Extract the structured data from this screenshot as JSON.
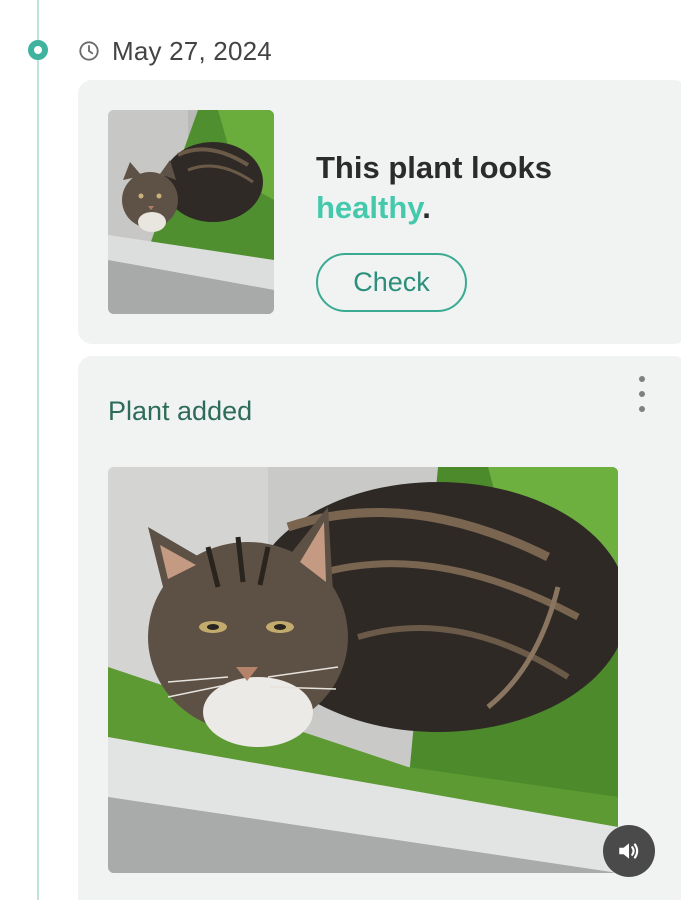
{
  "timeline": {
    "date": "May 27, 2024",
    "clock_icon": "clock-icon"
  },
  "health_card": {
    "message_prefix": "This plant looks",
    "status_word": "healthy",
    "message_suffix": ".",
    "status_color": "#45c9ad",
    "check_label": "Check",
    "thumbnail": "cat-in-grass-planter-photo"
  },
  "added_card": {
    "title": "Plant added",
    "menu_icon": "more-vertical-icon",
    "photo": "cat-in-grass-planter-photo"
  },
  "overlay": {
    "sound_icon": "volume-icon"
  },
  "colors": {
    "accent": "#3fb39e",
    "card_background": "#f0f3f2",
    "title_green": "#2e6b5b"
  }
}
